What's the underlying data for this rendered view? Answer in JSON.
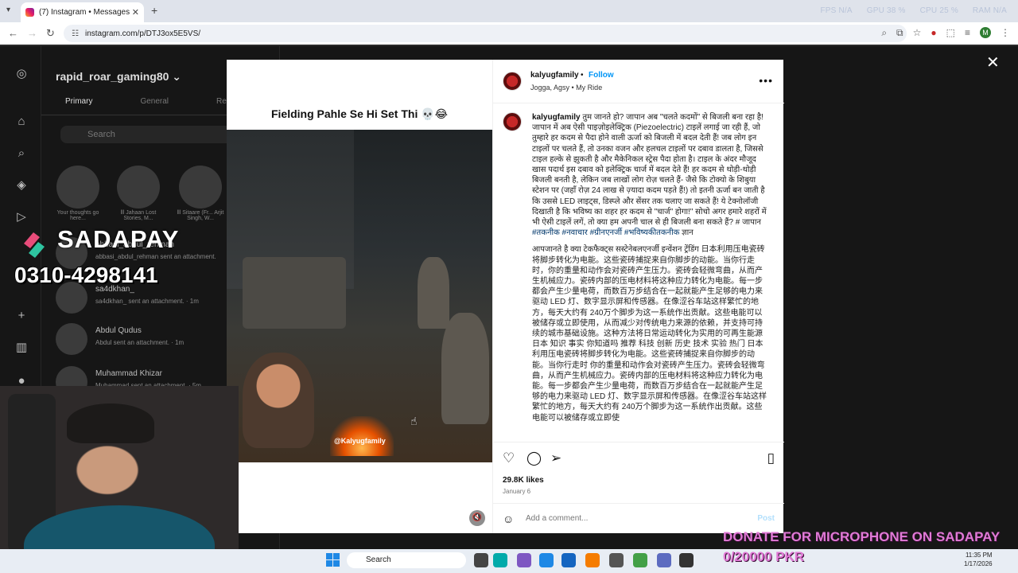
{
  "browser": {
    "tab_title": "(7) Instagram • Messages",
    "url": "instagram.com/p/DTJ3ox5E5VS/",
    "perf": [
      "FPS N/A",
      "GPU 38 %",
      "CPU 25 %",
      "RAM N/A"
    ],
    "profile_initial": "M"
  },
  "instagram": {
    "username": "rapid_roar_gaming80",
    "tabs": [
      "Primary",
      "General",
      "Req"
    ],
    "search_placeholder": "Search",
    "stories": [
      {
        "name": "Your thoughts go here..."
      },
      {
        "name": "lll Jahaan Lost Stories, M..."
      },
      {
        "name": "lll Sitaare (Fr... Arjit Singh, W..."
      }
    ],
    "threads": [
      {
        "name": "abbasi_abdul_rehman",
        "msg": "abbasi_abdul_rehman sent an attachment."
      },
      {
        "name": "sa4dkhan_",
        "msg": "sa4dkhan_ sent an attachment. · 1m"
      },
      {
        "name": "Abdul Qudus",
        "msg": "Abdul sent an attachment. · 1m"
      },
      {
        "name": "Muhammad Khizar",
        "msg": "Muhammad sent an attachment. · 5m"
      }
    ]
  },
  "post": {
    "media_title": "Fielding Pahle Se Hi Set Thi 💀😂",
    "watermark": "@Kalyugfamily",
    "author": "kalyugfamily",
    "follow_label": "Follow",
    "location": "Jogga, Agsy • My Ride",
    "caption_hindi": "तुम जानते हो? जापान अब \"चलते कदमों\" से बिजली बना रहा है! जापान में अब ऐसी पाइज़ोइलेक्ट्रिक (Piezoelectric) टाइलें लगाई जा रही हैं, जो तुम्हारे हर कदम से पैदा होने वाली ऊर्जा को बिजली में बदल देती हैं! जब लोग इन टाइलों पर चलते हैं, तो उनका वजन और हलचल टाइलों पर दबाव डालता है, जिससे टाइल हल्के से झुकती है और मैकेनिकल स्ट्रेस पैदा होता है। टाइल के अंदर मौजूद खास पदार्थ इस दबाव को इलेक्ट्रिक चार्ज में बदल देते हैं! हर कदम से थोड़ी-थोड़ी बिजली बनती है, लेकिन जब लाखों लोग रोज़ चलते हैं- जैसे कि टोक्यो के शिबुया स्टेशन पर (जहाँ रोज़ 24 लाख से ज़्यादा कदम पड़ते हैं!) तो इतनी ऊर्जा बन जाती है कि उससे LED लाइट्स, डिस्प्ले और सेंसर तक चलाए जा सकते हैं! ये टेक्नोलॉजी दिखाती है कि भविष्य का शहर हर कदम से \"चार्ज\" होगा!\" सोचो अगर हमारे शहरों में भी ऐसी टाइलें लगें, तो क्या हम अपनी चाल से ही बिजली बना सकते हैं? # जापान",
    "caption_tags": "#तकनीक #नवाचार #ग्रीनएनर्जी #भविष्यकीतकनीक",
    "caption_tail": " ज्ञान",
    "caption_cjk": "आपजानते है क्या टेकफैक्ट्स सस्टेनेबलएनर्जी इन्वेंशन ट्रेंडिंग 日本利用压电瓷砖将脚步转化为电能。这些瓷砖捕捉来自你脚步的动能。当你行走时，你的重量和动作会对瓷砖产生压力。瓷砖会轻微弯曲，从而产生机械应力。瓷砖内部的压电材料将这种应力转化为电能。每一步都会产生少量电荷，而数百万步结合在一起就能产生足够的电力来驱动 LED 灯、数字显示屏和传感器。在像涩谷车站这样繁忙的地方，每天大约有 240万个脚步为这一系统作出贡献。这些电能可以被储存或立即使用，从而减少对传统电力来源的依赖，并支持可持续的城市基础设施。这种方法将日常运动转化为实用的可再生能源 日本 知识 事实 你知道吗 推荐 科技 创新 历史 技术 实验 热门 日本利用压电瓷砖将脚步转化为电能。这些瓷砖捕捉来自你脚步的动能。当你行走时 你的重量和动作会对瓷砖产生压力。瓷砖会轻微弯曲，从而产生机械应力。瓷砖内部的压电材料将这种应力转化为电能。每一步都会产生少量电荷，而数百万步结合在一起就能产生足够的电力来驱动 LED 灯、数字显示屏和传感器。在像涩谷车站这样繁忙的地方，每天大约有 240万个脚步为这一系统作出贡献。这些电能可以被储存或立即使",
    "likes": "29.8K likes",
    "date": "January 6",
    "comment_placeholder": "Add a comment...",
    "post_label": "Post"
  },
  "overlay": {
    "brand": "SADAPAY",
    "phone": "0310-4298141",
    "donate_line1": "DONATE FOR MICROPHONE ON SADAPAY",
    "donate_line2": "0/20000 PKR"
  },
  "taskbar": {
    "search_label": "Search",
    "time": "11:35 PM",
    "date": "1/17/2026"
  }
}
